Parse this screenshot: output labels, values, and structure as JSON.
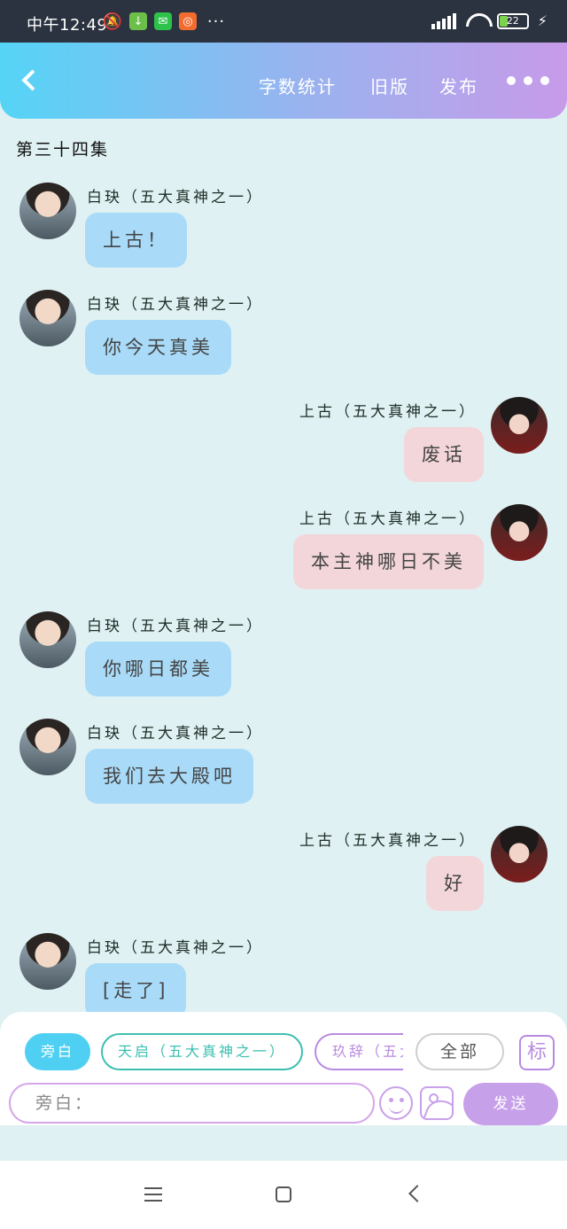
{
  "status_bar": {
    "time": "中午12:49",
    "battery": "22",
    "more_glyph": "···"
  },
  "header": {
    "word_count": "字数统计",
    "old_version": "旧版",
    "publish": "发布"
  },
  "episode_title": "第三十四集",
  "messages": [
    {
      "side": "left",
      "sender": "白玦（五大真神之一）",
      "text": "上古！"
    },
    {
      "side": "left",
      "sender": "白玦（五大真神之一）",
      "text": "你今天真美"
    },
    {
      "side": "right",
      "sender": "上古（五大真神之一）",
      "text": "废话"
    },
    {
      "side": "right",
      "sender": "上古（五大真神之一）",
      "text": "本主神哪日不美"
    },
    {
      "side": "left",
      "sender": "白玦（五大真神之一）",
      "text": "你哪日都美"
    },
    {
      "side": "left",
      "sender": "白玦（五大真神之一）",
      "text": "我们去大殿吧"
    },
    {
      "side": "right",
      "sender": "上古（五大真神之一）",
      "text": "好"
    },
    {
      "side": "left",
      "sender": "白玦（五大真神之一）",
      "text": "[走了]"
    }
  ],
  "composer": {
    "roles": [
      "旁白",
      "天启（五大真神之一）",
      "玖辞（五大"
    ],
    "all": "全部",
    "tag": "标",
    "placeholder": "旁白：",
    "send": "发送"
  },
  "colors": {
    "header_gradient_start": "#55d4f6",
    "header_gradient_end": "#c79be9",
    "bubble_left": "#a9dbf9",
    "bubble_right": "#f3d6da",
    "background": "#dff1f2",
    "send_button": "#c7a0ea"
  },
  "icons": {
    "back": "chevron-left-icon",
    "more": "more-dots-icon",
    "emoji": "smiley-icon",
    "image": "image-icon"
  }
}
